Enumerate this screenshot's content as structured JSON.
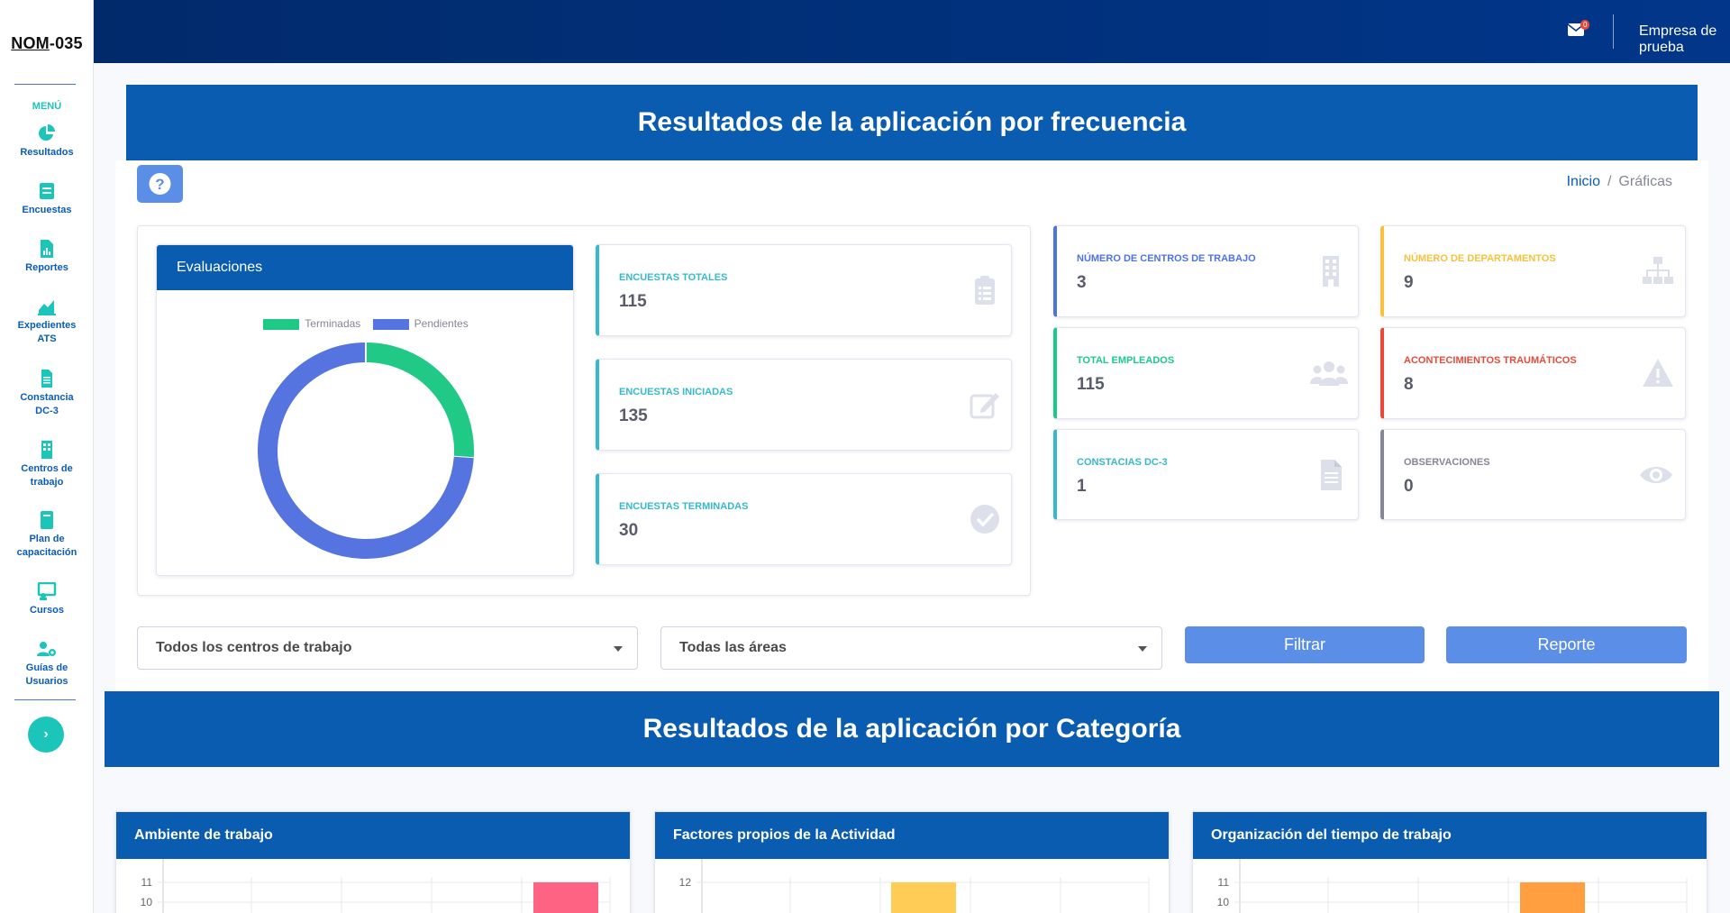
{
  "brand": {
    "part1": "NOM",
    "part2": "-035"
  },
  "sidebar": {
    "menu_label": "MENÚ",
    "items": [
      {
        "l1": "Resultados",
        "l2": ""
      },
      {
        "l1": "Encuestas",
        "l2": ""
      },
      {
        "l1": "Reportes",
        "l2": ""
      },
      {
        "l1": "Expedientes",
        "l2": "ATS"
      },
      {
        "l1": "Constancia",
        "l2": "DC-3"
      },
      {
        "l1": "Centros de",
        "l2": "trabajo"
      },
      {
        "l1": "Plan de",
        "l2": "capacitación"
      },
      {
        "l1": "Cursos",
        "l2": ""
      },
      {
        "l1": "Guías de",
        "l2": "Usuarios"
      }
    ],
    "toggle_glyph": "›"
  },
  "topbar": {
    "mail_badge": "0",
    "company": "Empresa de prueba"
  },
  "banner1": {
    "title": "Resultados de la aplicación por frecuencia"
  },
  "breadcrumb": {
    "home": "Inicio",
    "current": "Gráficas"
  },
  "evaluaciones": {
    "title": "Evaluaciones",
    "legend": [
      {
        "label": "Terminadas",
        "color": "#20c985"
      },
      {
        "label": "Pendientes",
        "color": "#5574df"
      }
    ]
  },
  "chart_data": {
    "type": "pie",
    "title": "Evaluaciones",
    "categories": [
      "Terminadas",
      "Pendientes"
    ],
    "values": [
      30,
      85
    ],
    "donut": true,
    "legend_position": "top"
  },
  "stats_left": [
    {
      "label": "ENCUESTAS TOTALES",
      "value": "115",
      "icon": "clipboard-list-icon"
    },
    {
      "label": "ENCUESTAS INICIADAS",
      "value": "135",
      "icon": "edit-icon"
    },
    {
      "label": "ENCUESTAS TERMINADAS",
      "value": "30",
      "icon": "check-circle-icon"
    }
  ],
  "stats_right": [
    {
      "label": "NÚMERO DE CENTROS DE TRABAJO",
      "value": "3",
      "icon": "building-icon",
      "color": "#4e73df"
    },
    {
      "label": "NÚMERO DE DEPARTAMENTOS",
      "value": "9",
      "icon": "sitemap-icon",
      "color": "#f6c23e"
    },
    {
      "label": "TOTAL EMPLEADOS",
      "value": "115",
      "icon": "users-icon",
      "color": "#1cc88a"
    },
    {
      "label": "ACONTECIMIENTOS TRAUMÁTICOS",
      "value": "8",
      "icon": "warning-icon",
      "color": "#e74a3b"
    },
    {
      "label": "CONSTACIAS DC-3",
      "value": "1",
      "icon": "file-icon",
      "color": "#36b9cc"
    },
    {
      "label": "OBSERVACIONES",
      "value": "0",
      "icon": "eye-icon",
      "color": "#858796"
    }
  ],
  "filters": {
    "centros": "Todos los centros de trabajo",
    "areas": "Todas las áreas",
    "filter_btn": "Filtrar",
    "report_btn": "Reporte"
  },
  "banner2": {
    "title": "Resultados de la aplicación por Categoría"
  },
  "categories": [
    {
      "title": "Ambiente de trabajo",
      "ticks": [
        "11",
        "10"
      ],
      "bar_color": "#ff6384"
    },
    {
      "title": "Factores propios de la Actividad",
      "ticks": [
        "12",
        ""
      ],
      "bar_color": "#ffcd56"
    },
    {
      "title": "Organización del tiempo de trabajo",
      "ticks": [
        "11",
        "10"
      ],
      "bar_color": "#ff9f40"
    }
  ],
  "colors": {
    "primary": "#0a5cb0",
    "topbar": "#012a6b",
    "accent": "#1cc5b9",
    "button": "#5b8ee6"
  }
}
